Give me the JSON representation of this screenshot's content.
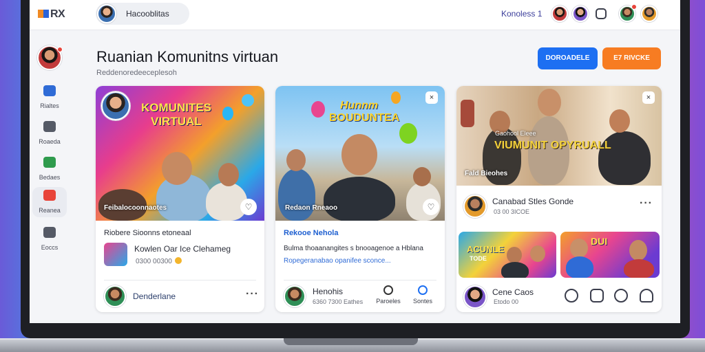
{
  "topbar": {
    "logo": "RX",
    "search_text": "Hacooblitas",
    "link": "Konoless 1"
  },
  "sidebar": {
    "items": [
      {
        "label": "Rialtes",
        "icon": "people-icon",
        "color": "#2f6bd6"
      },
      {
        "label": "Roaeda",
        "icon": "group-icon",
        "color": "#555a66"
      },
      {
        "label": "Bedaes",
        "icon": "book-icon",
        "color": "#2f9b4d"
      },
      {
        "label": "Reanea",
        "icon": "home-icon",
        "color": "#e8443a"
      },
      {
        "label": "Eoccs",
        "icon": "trash-icon",
        "color": "#555a66"
      }
    ]
  },
  "page": {
    "title": "Ruanian Komunitns virtuan",
    "subtitle": "Reddenoredeeceplesoh",
    "btn_blue": "DOROADELE",
    "btn_orange": "E7 RIVCKE",
    "accent_blue": "#1d6ff2",
    "accent_orange": "#f77c22"
  },
  "card1": {
    "image_title_line1": "KOMUNITES",
    "image_title_line2": "VIRTUAL",
    "image_caption": "Feibalocoonnaotes",
    "heading": "Riobere Sioonns etoneaal",
    "item_title": "Kowlen Oar Ice Clehameg",
    "item_meta": "0300 00300",
    "footer_name": "Denderlane"
  },
  "card2": {
    "image_title_line1": "Hunnm",
    "image_title_line2": "BOUDUNTEA",
    "image_caption": "Redaon Rneaoo",
    "heading": "Rekooe Nehola",
    "body": "Bulma thoaanangites s bnooagenoe a Hblana",
    "link": "Ropegeranabao opanifee sconce...",
    "footer_name": "Henohis",
    "footer_meta": "6360 7300 Eathes",
    "action1": "Paroeles",
    "action2": "Sontes"
  },
  "card3": {
    "image_caption_top": "Gaohool Eleee",
    "image_title": "VIUMUNIT OPYRUALL",
    "image_caption": "Fald Bieohes",
    "item_title": "Canabad Stles Gonde",
    "item_meta": "03 00 3ICOE",
    "thumb1_text": "ACUNLE",
    "thumb1_sub": "TODE",
    "thumb2_text": "DUI",
    "footer_name": "Cene Caos",
    "footer_meta": "Etodo 00"
  }
}
